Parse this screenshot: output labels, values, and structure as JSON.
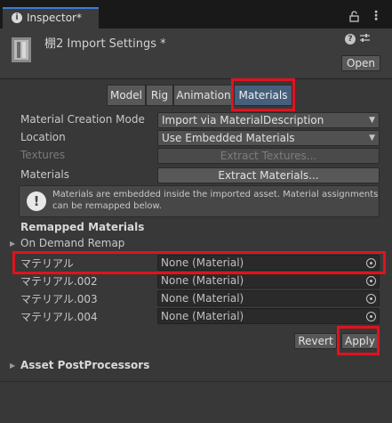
{
  "window": {
    "tab_title": "Inspector*"
  },
  "header": {
    "title": "棚2 Import Settings *",
    "open_label": "Open"
  },
  "tabs": [
    {
      "label": "Model"
    },
    {
      "label": "Rig"
    },
    {
      "label": "Animation"
    },
    {
      "label": "Materials",
      "active": true
    }
  ],
  "properties": {
    "creation_mode_label": "Material Creation Mode",
    "creation_mode_value": "Import via MaterialDescription",
    "location_label": "Location",
    "location_value": "Use Embedded Materials",
    "textures_label": "Textures",
    "extract_textures_label": "Extract Textures...",
    "materials_label": "Materials",
    "extract_materials_label": "Extract Materials..."
  },
  "info": {
    "message": "Materials are embedded inside the imported asset. Material assignments can be remapped below."
  },
  "remap": {
    "heading": "Remapped Materials",
    "on_demand_label": "On Demand Remap",
    "rows": [
      {
        "name": "マテリアル",
        "value": "None (Material)"
      },
      {
        "name": "マテリアル.002",
        "value": "None (Material)"
      },
      {
        "name": "マテリアル.003",
        "value": "None (Material)"
      },
      {
        "name": "マテリアル.004",
        "value": "None (Material)"
      }
    ]
  },
  "actions": {
    "revert_label": "Revert",
    "apply_label": "Apply"
  },
  "postprocessors": {
    "label": "Asset PostProcessors"
  },
  "colors": {
    "background": "#383838",
    "active_tab": "#46607c",
    "highlight": "#e0121f",
    "tab_accent": "#3a7bd5"
  }
}
